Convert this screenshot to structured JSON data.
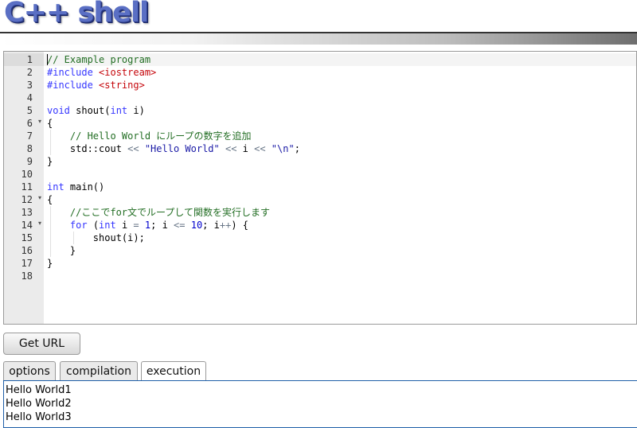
{
  "header": {
    "title": "C++ shell"
  },
  "editor": {
    "lines": [
      {
        "num": "1",
        "fold": ""
      },
      {
        "num": "2",
        "fold": ""
      },
      {
        "num": "3",
        "fold": ""
      },
      {
        "num": "4",
        "fold": ""
      },
      {
        "num": "5",
        "fold": ""
      },
      {
        "num": "6",
        "fold": "▾"
      },
      {
        "num": "7",
        "fold": ""
      },
      {
        "num": "8",
        "fold": ""
      },
      {
        "num": "9",
        "fold": ""
      },
      {
        "num": "10",
        "fold": ""
      },
      {
        "num": "11",
        "fold": ""
      },
      {
        "num": "12",
        "fold": "▾"
      },
      {
        "num": "13",
        "fold": ""
      },
      {
        "num": "14",
        "fold": "▾"
      },
      {
        "num": "15",
        "fold": ""
      },
      {
        "num": "16",
        "fold": ""
      },
      {
        "num": "17",
        "fold": ""
      },
      {
        "num": "18",
        "fold": ""
      }
    ],
    "code": {
      "l1_comment": "// Example program",
      "l2_directive": "#include ",
      "l2_header": "<iostream>",
      "l3_directive": "#include ",
      "l3_header": "<string>",
      "l5_type": "void",
      "l5_name": " shout(",
      "l5_param_type": "int",
      "l5_rest": " i)",
      "l6": "{",
      "l7_comment": "// Hello World にループの数字を追加",
      "l8_a": "std::cout ",
      "l8_op1": "<<",
      "l8_str": " \"Hello World\" ",
      "l8_op2": "<<",
      "l8_i": " i ",
      "l8_op3": "<<",
      "l8_str2": " \"\\n\"",
      "l8_end": ";",
      "l9": "}",
      "l11_type": "int",
      "l11_rest": " main()",
      "l12": "{",
      "l13_comment": "//ここでfor文でループして関数を実行します",
      "l14_for": "for",
      "l14_a": " (",
      "l14_int": "int",
      "l14_b": " i ",
      "l14_eq": "=",
      "l14_c": " ",
      "l14_one": "1",
      "l14_d": "; i ",
      "l14_le": "<=",
      "l14_e": " ",
      "l14_ten": "10",
      "l14_f": "; i",
      "l14_pp": "++",
      "l14_g": ") {",
      "l15": "shout(i);",
      "l16": "}",
      "l17": "}"
    }
  },
  "toolbar": {
    "get_url_label": "Get URL"
  },
  "tabs": [
    {
      "label": "options"
    },
    {
      "label": "compilation"
    },
    {
      "label": "execution"
    }
  ],
  "output": {
    "lines": [
      "Hello World1",
      "Hello World2",
      "Hello World3"
    ]
  }
}
